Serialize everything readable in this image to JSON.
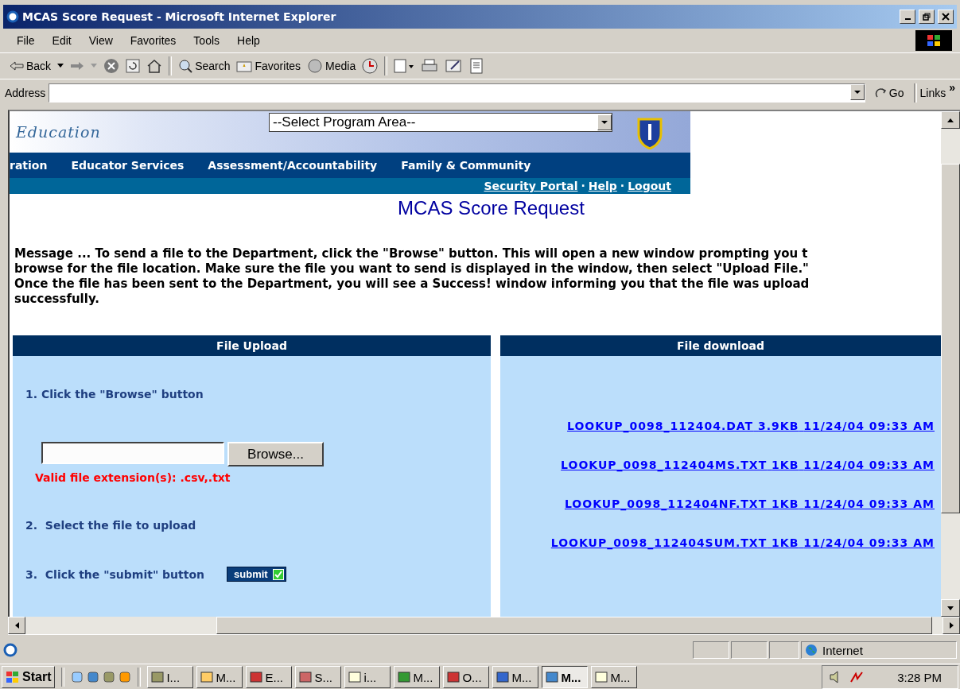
{
  "window": {
    "title": "MCAS Score Request - Microsoft Internet Explorer"
  },
  "menu": [
    "File",
    "Edit",
    "View",
    "Favorites",
    "Tools",
    "Help"
  ],
  "toolbar": {
    "back": "Back",
    "search": "Search",
    "favorites": "Favorites",
    "media": "Media"
  },
  "address": {
    "label": "Address",
    "go": "Go",
    "links": "Links",
    "more": "»"
  },
  "header": {
    "logo_text": "Education",
    "program_select": "--Select Program Area--",
    "nav": [
      "ration",
      "Educator Services",
      "Assessment/Accountability",
      "Family & Community"
    ],
    "utility_links": [
      "Security Portal",
      "Help",
      "Logout"
    ],
    "separator": "·"
  },
  "page_title": "MCAS Score Request",
  "message": [
    "Message ... To send a file to the Department, click the \"Browse\" button. This will open a new window prompting you t",
    "browse for the file location. Make sure the file you want to send is displayed in the window, then select \"Upload File.\"",
    "Once the file has been sent to the Department, you will see a Success! window informing you that the file was upload",
    "successfully."
  ],
  "upload": {
    "title": "File Upload",
    "step_1": {
      "number": "1.",
      "text": "Click the \"Browse\" button"
    },
    "browse_button": "Browse...",
    "valid_extensions": "Valid file extension(s): .csv,.txt",
    "step_2": {
      "number": "2.",
      "text": "Select the file to upload"
    },
    "step_3": {
      "number": "3.",
      "text": "Click the \"submit\" button"
    },
    "submit_button": "submit"
  },
  "download": {
    "title": "File download",
    "files": [
      {
        "name": "LOOKUP_0098_112404.DAT",
        "size": "3.9KB",
        "date": "11/24/04 09:33 AM"
      },
      {
        "name": "LOOKUP_0098_112404MS.TXT",
        "size": "1KB",
        "date": "11/24/04 09:33 AM"
      },
      {
        "name": "LOOKUP_0098_112404NF.TXT",
        "size": "1KB",
        "date": "11/24/04 09:33 AM"
      },
      {
        "name": "LOOKUP_0098_112404SUM.TXT",
        "size": "1KB",
        "date": "11/24/04 09:33 AM"
      }
    ]
  },
  "status_bar": {
    "zone": "Internet"
  },
  "taskbar": {
    "start": "Start",
    "tasks": [
      {
        "label": "I...",
        "selected": false
      },
      {
        "label": "M...",
        "selected": false
      },
      {
        "label": "E...",
        "selected": false
      },
      {
        "label": "S...",
        "selected": false
      },
      {
        "label": "i...",
        "selected": false
      },
      {
        "label": "M...",
        "selected": false
      },
      {
        "label": "O...",
        "selected": false
      },
      {
        "label": "M...",
        "selected": false
      },
      {
        "label": "M...",
        "selected": true
      },
      {
        "label": "M...",
        "selected": false
      }
    ],
    "clock": "3:28 PM"
  }
}
